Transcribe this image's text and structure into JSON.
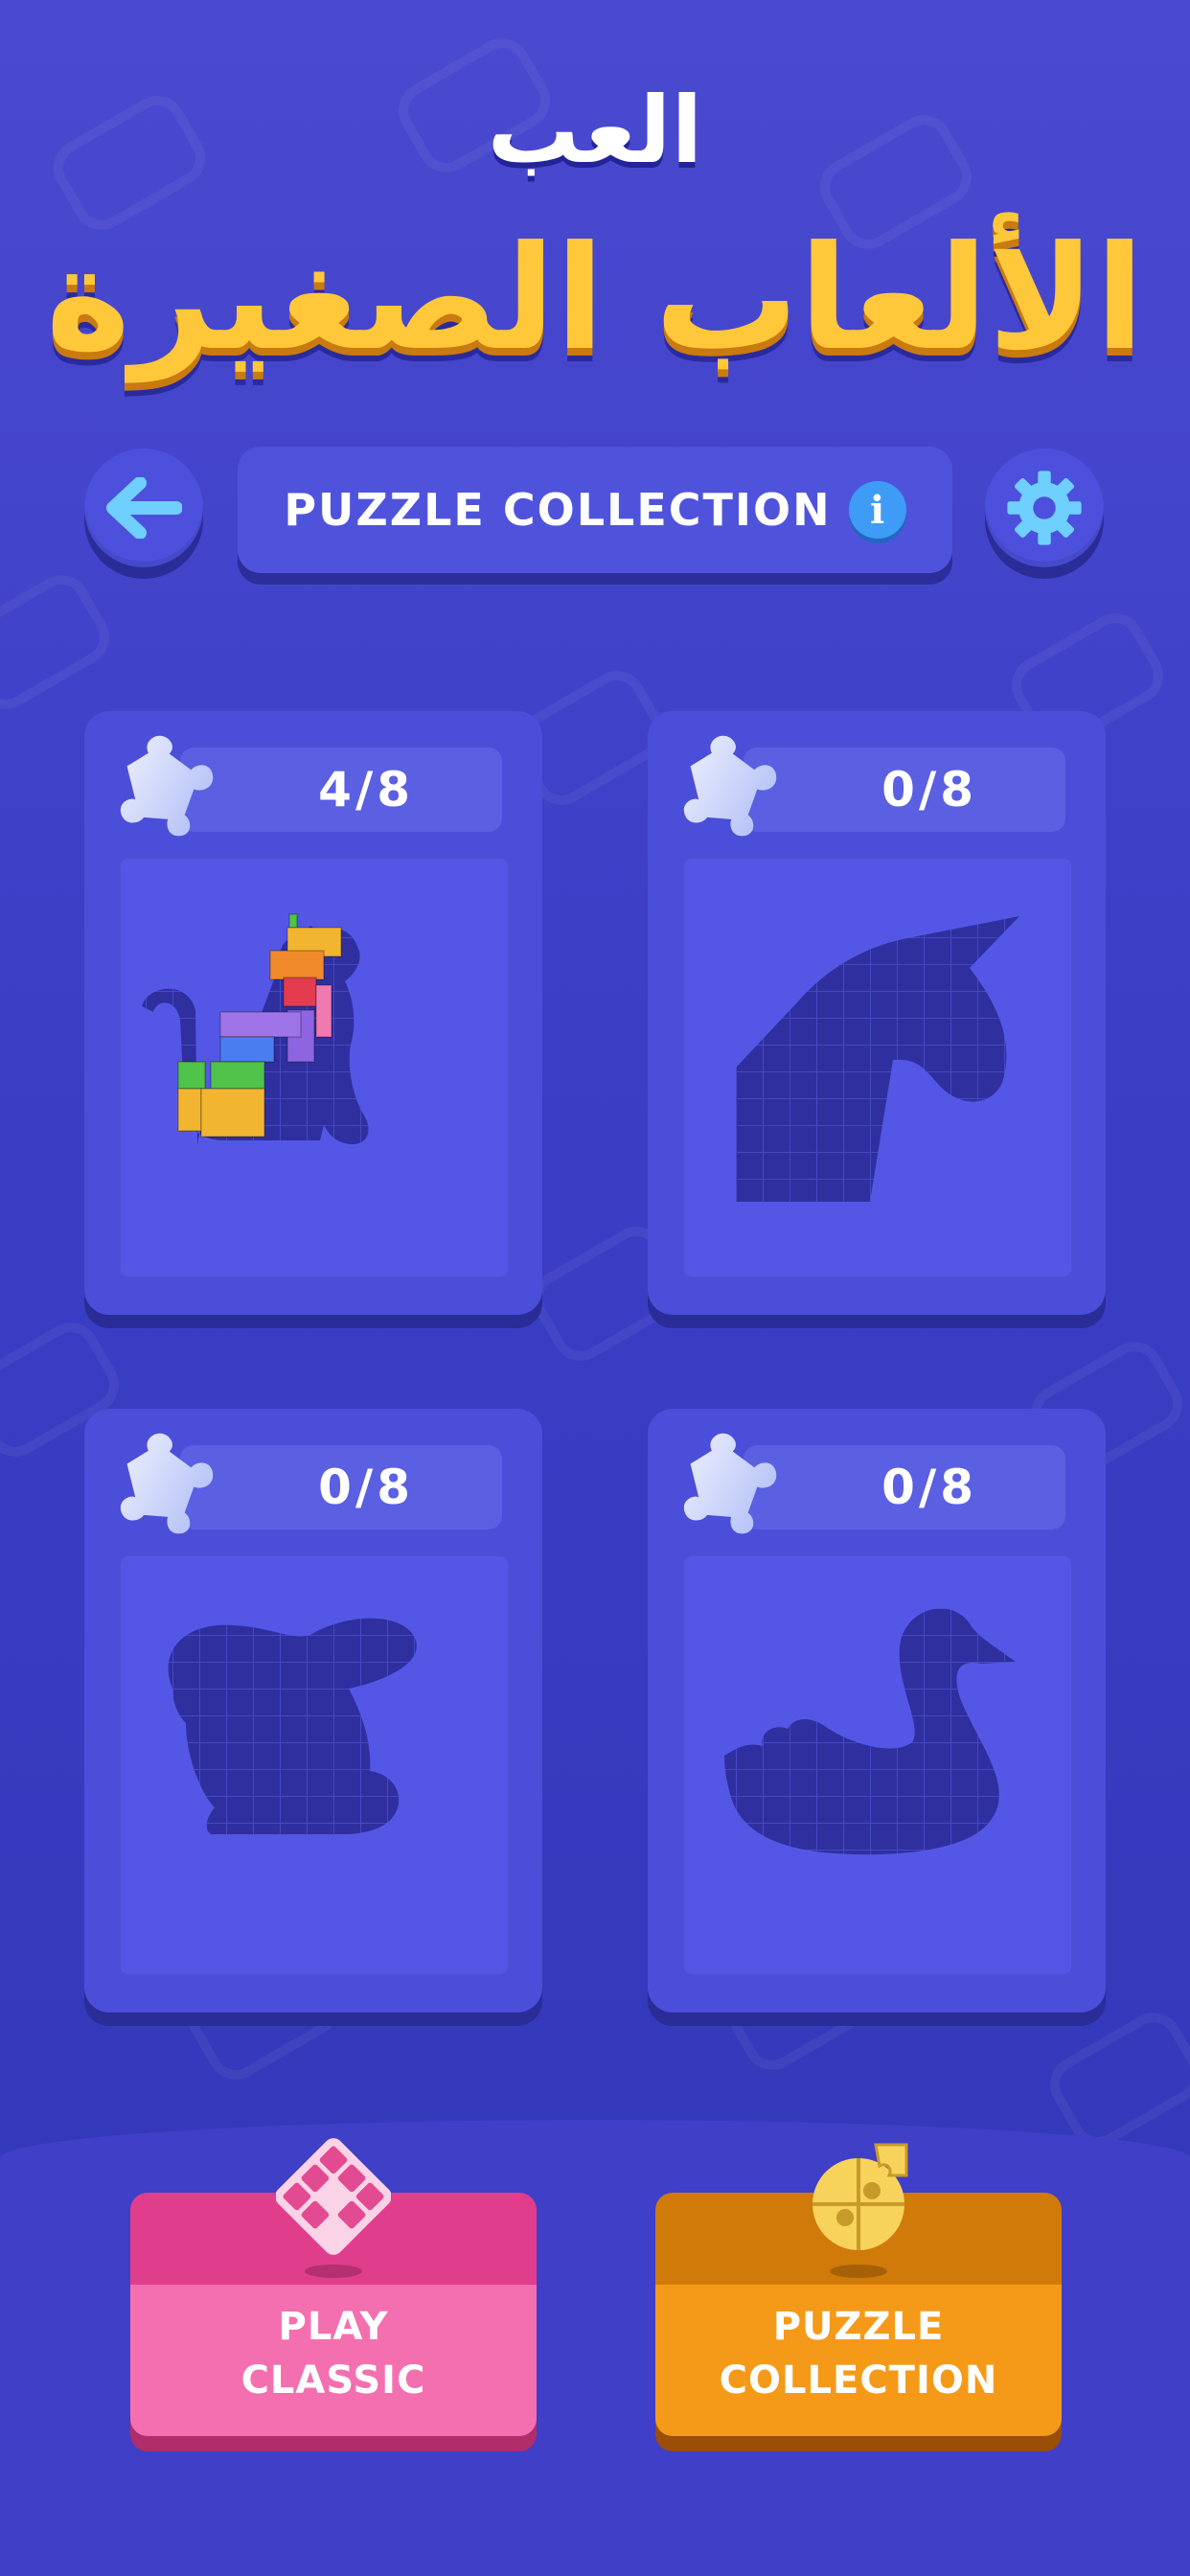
{
  "header": {
    "title_small": "العب",
    "title_big": "الألعاب الصغيرة",
    "bar_title": "PUZZLE COLLECTION"
  },
  "cards": [
    {
      "progress": "4/8",
      "silhouette": "cat"
    },
    {
      "progress": "0/8",
      "silhouette": "unicorn"
    },
    {
      "progress": "0/8",
      "silhouette": "rabbit"
    },
    {
      "progress": "0/8",
      "silhouette": "swan"
    }
  ],
  "bottom": {
    "play_classic_label": "PLAY\nCLASSIC",
    "puzzle_collection_label": "PUZZLE\nCOLLECTION"
  },
  "icons": {
    "back": "arrow-left-icon",
    "settings": "gear-icon",
    "info": "info-icon",
    "card_badge": "puzzle-piece-icon",
    "play_classic": "diamond-grid-icon",
    "puzzle_collection": "jigsaw-icon"
  },
  "colors": {
    "background": "#3b3fc6",
    "title_gold": "#ffc83a",
    "accent_blue": "#3e9cf6",
    "play_pink": "#f46fb0",
    "puzzle_orange": "#f59a18"
  }
}
